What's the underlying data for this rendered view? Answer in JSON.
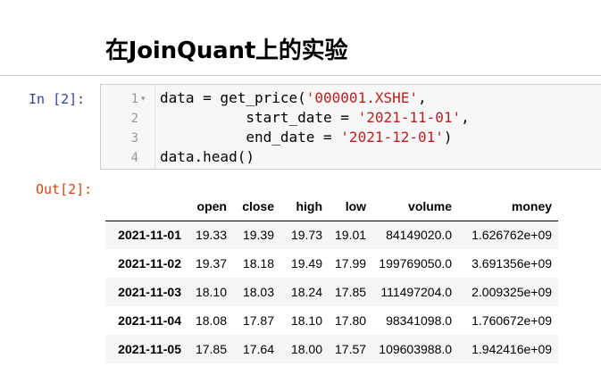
{
  "section_title": "在JoinQuant上的实验",
  "input_prompt": "In  [2]:",
  "output_prompt": "Out[2]:",
  "code": {
    "line_numbers": [
      "1",
      "2",
      "3",
      "4"
    ],
    "fold_marker": "▾",
    "lines": [
      [
        {
          "t": "data = get_price("
        },
        {
          "t": "'000001.XSHE'",
          "s": "str"
        },
        {
          "t": ","
        }
      ],
      [
        {
          "t": "          start_date = "
        },
        {
          "t": "'2021-11-01'",
          "s": "str"
        },
        {
          "t": ","
        }
      ],
      [
        {
          "t": "          end_date = "
        },
        {
          "t": "'2021-12-01'",
          "s": "str"
        },
        {
          "t": ")"
        }
      ],
      [
        {
          "t": "data.head()"
        }
      ]
    ]
  },
  "table": {
    "columns": [
      "",
      "open",
      "close",
      "high",
      "low",
      "volume",
      "money"
    ],
    "rows": [
      {
        "index": "2021-11-01",
        "values": [
          "19.33",
          "19.39",
          "19.73",
          "19.01",
          "84149020.0",
          "1.626762e+09"
        ]
      },
      {
        "index": "2021-11-02",
        "values": [
          "19.37",
          "18.18",
          "19.49",
          "17.99",
          "199769050.0",
          "3.691356e+09"
        ]
      },
      {
        "index": "2021-11-03",
        "values": [
          "18.10",
          "18.03",
          "18.24",
          "17.85",
          "111497204.0",
          "2.009325e+09"
        ]
      },
      {
        "index": "2021-11-04",
        "values": [
          "18.08",
          "17.87",
          "18.10",
          "17.80",
          "98341098.0",
          "1.760672e+09"
        ]
      },
      {
        "index": "2021-11-05",
        "values": [
          "17.85",
          "17.64",
          "18.00",
          "17.57",
          "109603988.0",
          "1.942416e+09"
        ]
      }
    ]
  }
}
